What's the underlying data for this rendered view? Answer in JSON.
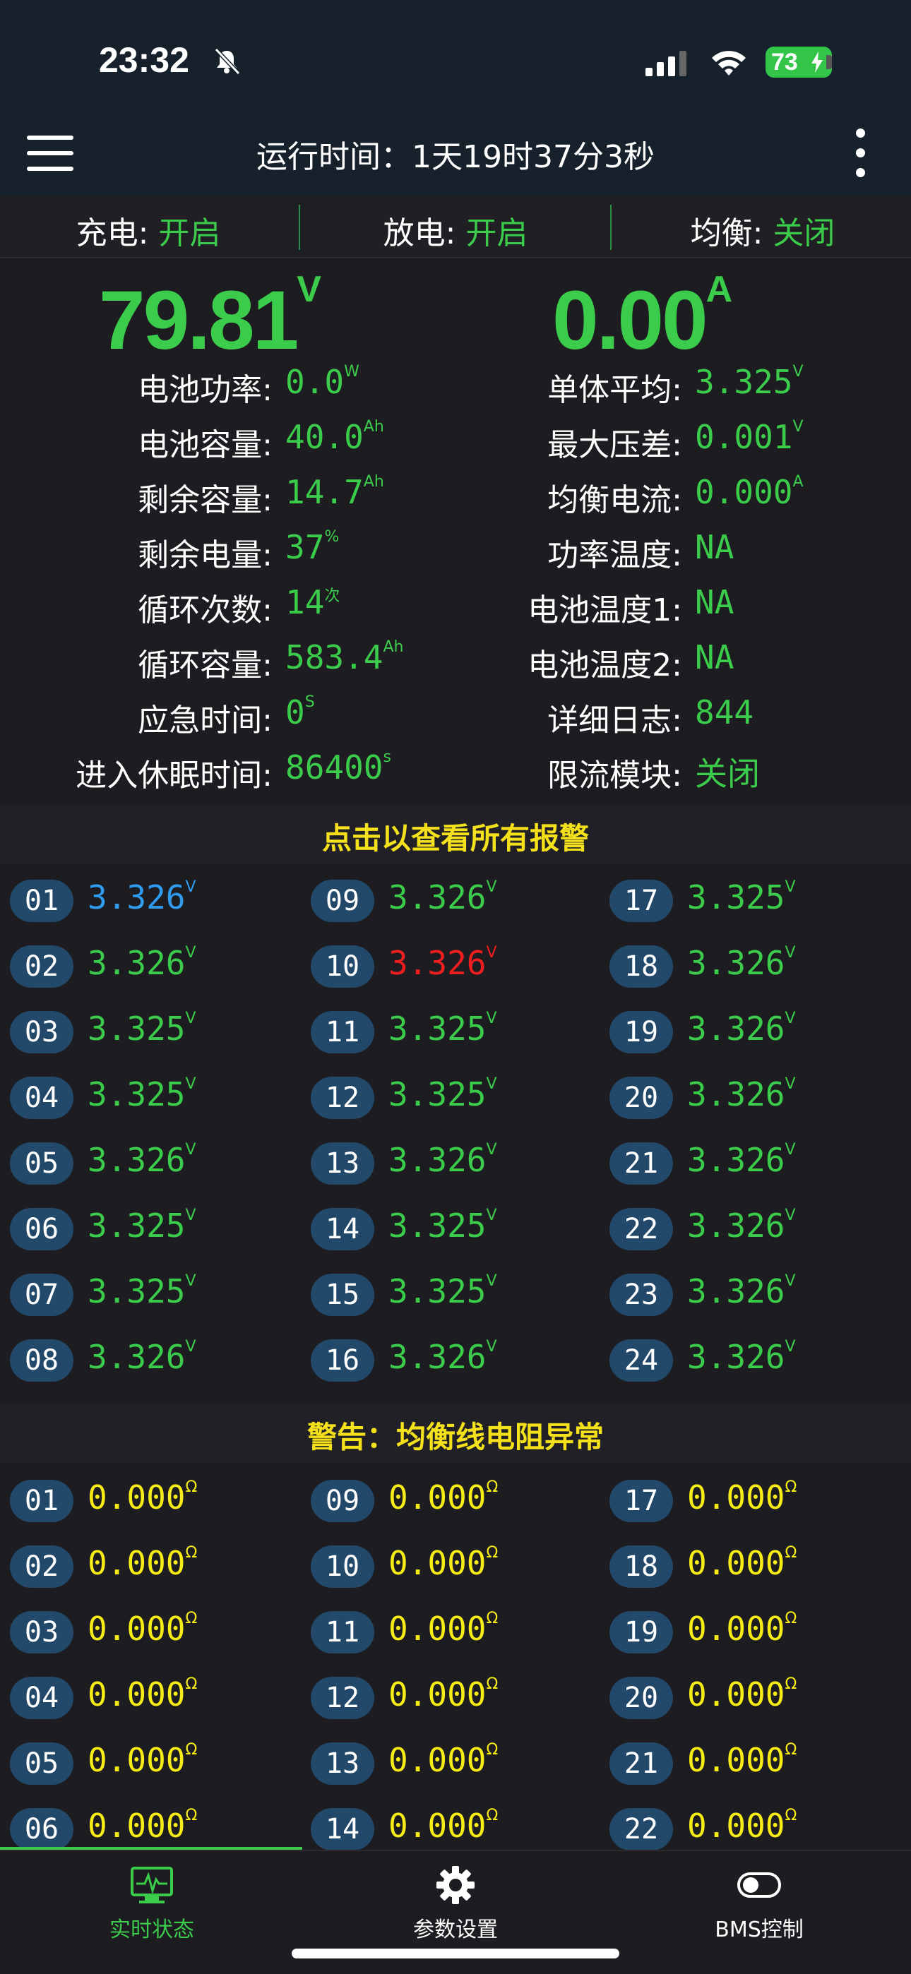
{
  "status_bar": {
    "time": "23:32",
    "battery": "73"
  },
  "header": {
    "title": "运行时间：1天19时37分3秒"
  },
  "toggles": [
    {
      "label": "充电: ",
      "value": "开启"
    },
    {
      "label": "放电: ",
      "value": "开启"
    },
    {
      "label": "均衡: ",
      "value": "关闭"
    }
  ],
  "voltage": {
    "value": "79.81",
    "unit": "V"
  },
  "current": {
    "value": "0.00",
    "unit": "A"
  },
  "left_stats": [
    {
      "label": "电池功率:",
      "value": "0.0",
      "unit": "W"
    },
    {
      "label": "电池容量:",
      "value": "40.0",
      "unit": "Ah"
    },
    {
      "label": "剩余容量:",
      "value": "14.7",
      "unit": "Ah"
    },
    {
      "label": "剩余电量:",
      "value": "37",
      "unit": "%"
    },
    {
      "label": "循环次数:",
      "value": "14",
      "unit": "次"
    },
    {
      "label": "循环容量:",
      "value": "583.4",
      "unit": "Ah"
    },
    {
      "label": "应急时间:",
      "value": "0",
      "unit": "S"
    },
    {
      "label": "进入休眠时间:",
      "value": "86400",
      "unit": "s"
    }
  ],
  "right_stats": [
    {
      "label": "单体平均:",
      "value": "3.325",
      "unit": "V"
    },
    {
      "label": "最大压差:",
      "value": "0.001",
      "unit": "V"
    },
    {
      "label": "均衡电流:",
      "value": "0.000",
      "unit": "A"
    },
    {
      "label": "功率温度:",
      "value": "NA",
      "unit": ""
    },
    {
      "label": "电池温度1:",
      "value": "NA",
      "unit": ""
    },
    {
      "label": "电池温度2:",
      "value": "NA",
      "unit": ""
    },
    {
      "label": "详细日志:",
      "value": "844",
      "unit": ""
    },
    {
      "label": "限流模块:",
      "value": "关闭",
      "unit": ""
    }
  ],
  "alarm_link": "点击以查看所有报警",
  "cells": [
    {
      "id": "01",
      "value": "3.326",
      "unit": "V",
      "color": "#2f9cf0"
    },
    {
      "id": "02",
      "value": "3.326",
      "unit": "V",
      "color": "#3ccc4c"
    },
    {
      "id": "03",
      "value": "3.325",
      "unit": "V",
      "color": "#3ccc4c"
    },
    {
      "id": "04",
      "value": "3.325",
      "unit": "V",
      "color": "#3ccc4c"
    },
    {
      "id": "05",
      "value": "3.326",
      "unit": "V",
      "color": "#3ccc4c"
    },
    {
      "id": "06",
      "value": "3.325",
      "unit": "V",
      "color": "#3ccc4c"
    },
    {
      "id": "07",
      "value": "3.325",
      "unit": "V",
      "color": "#3ccc4c"
    },
    {
      "id": "08",
      "value": "3.326",
      "unit": "V",
      "color": "#3ccc4c"
    },
    {
      "id": "09",
      "value": "3.326",
      "unit": "V",
      "color": "#3ccc4c"
    },
    {
      "id": "10",
      "value": "3.326",
      "unit": "V",
      "color": "#f01e1e"
    },
    {
      "id": "11",
      "value": "3.325",
      "unit": "V",
      "color": "#3ccc4c"
    },
    {
      "id": "12",
      "value": "3.325",
      "unit": "V",
      "color": "#3ccc4c"
    },
    {
      "id": "13",
      "value": "3.326",
      "unit": "V",
      "color": "#3ccc4c"
    },
    {
      "id": "14",
      "value": "3.325",
      "unit": "V",
      "color": "#3ccc4c"
    },
    {
      "id": "15",
      "value": "3.325",
      "unit": "V",
      "color": "#3ccc4c"
    },
    {
      "id": "16",
      "value": "3.326",
      "unit": "V",
      "color": "#3ccc4c"
    },
    {
      "id": "17",
      "value": "3.325",
      "unit": "V",
      "color": "#3ccc4c"
    },
    {
      "id": "18",
      "value": "3.326",
      "unit": "V",
      "color": "#3ccc4c"
    },
    {
      "id": "19",
      "value": "3.326",
      "unit": "V",
      "color": "#3ccc4c"
    },
    {
      "id": "20",
      "value": "3.326",
      "unit": "V",
      "color": "#3ccc4c"
    },
    {
      "id": "21",
      "value": "3.326",
      "unit": "V",
      "color": "#3ccc4c"
    },
    {
      "id": "22",
      "value": "3.326",
      "unit": "V",
      "color": "#3ccc4c"
    },
    {
      "id": "23",
      "value": "3.326",
      "unit": "V",
      "color": "#3ccc4c"
    },
    {
      "id": "24",
      "value": "3.326",
      "unit": "V",
      "color": "#3ccc4c"
    }
  ],
  "warning_title": "警告：均衡线电阻异常",
  "resistances": [
    {
      "id": "01",
      "value": "0.000",
      "unit": "Ω"
    },
    {
      "id": "02",
      "value": "0.000",
      "unit": "Ω"
    },
    {
      "id": "03",
      "value": "0.000",
      "unit": "Ω"
    },
    {
      "id": "04",
      "value": "0.000",
      "unit": "Ω"
    },
    {
      "id": "05",
      "value": "0.000",
      "unit": "Ω"
    },
    {
      "id": "06",
      "value": "0.000",
      "unit": "Ω"
    },
    {
      "id": "09",
      "value": "0.000",
      "unit": "Ω"
    },
    {
      "id": "10",
      "value": "0.000",
      "unit": "Ω"
    },
    {
      "id": "11",
      "value": "0.000",
      "unit": "Ω"
    },
    {
      "id": "12",
      "value": "0.000",
      "unit": "Ω"
    },
    {
      "id": "13",
      "value": "0.000",
      "unit": "Ω"
    },
    {
      "id": "14",
      "value": "0.000",
      "unit": "Ω"
    },
    {
      "id": "17",
      "value": "0.000",
      "unit": "Ω"
    },
    {
      "id": "18",
      "value": "0.000",
      "unit": "Ω"
    },
    {
      "id": "19",
      "value": "0.000",
      "unit": "Ω"
    },
    {
      "id": "20",
      "value": "0.000",
      "unit": "Ω"
    },
    {
      "id": "21",
      "value": "0.000",
      "unit": "Ω"
    },
    {
      "id": "22",
      "value": "0.000",
      "unit": "Ω"
    }
  ],
  "tabs": [
    {
      "label": "实时状态",
      "icon": "monitor-pulse-icon",
      "active": true
    },
    {
      "label": "参数设置",
      "icon": "gear-icon",
      "active": false
    },
    {
      "label": "BMS控制",
      "icon": "toggle-switch-icon",
      "active": false
    }
  ],
  "colors": {
    "green": "#3ccc4c",
    "yellow": "#f7ec16",
    "red": "#f01e1e",
    "blue": "#2f9cf0",
    "badge": "#23496a",
    "header": "#16212b"
  }
}
